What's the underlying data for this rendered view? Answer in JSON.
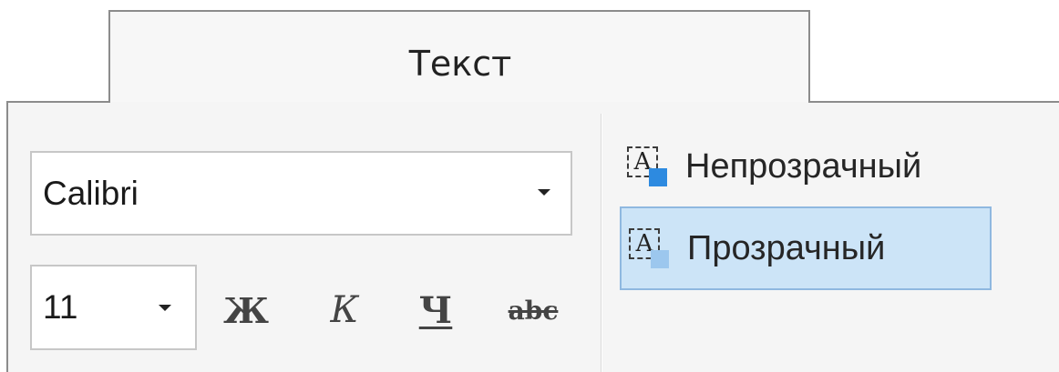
{
  "tab": {
    "label": "Текст"
  },
  "font": {
    "family_value": "Calibri",
    "size_value": "11"
  },
  "format_buttons": {
    "bold": "Ж",
    "italic": "К",
    "underline": "Ч",
    "strikethrough": "abc"
  },
  "background_mode": {
    "options": [
      {
        "label": "Непрозрачный",
        "icon_letter": "A",
        "selected": false
      },
      {
        "label": "Прозрачный",
        "icon_letter": "A",
        "selected": true
      }
    ]
  },
  "colors": {
    "selection_fill": "#cce4f7",
    "selection_border": "#8fb8e0",
    "icon_fill": "#2d8ae0"
  }
}
